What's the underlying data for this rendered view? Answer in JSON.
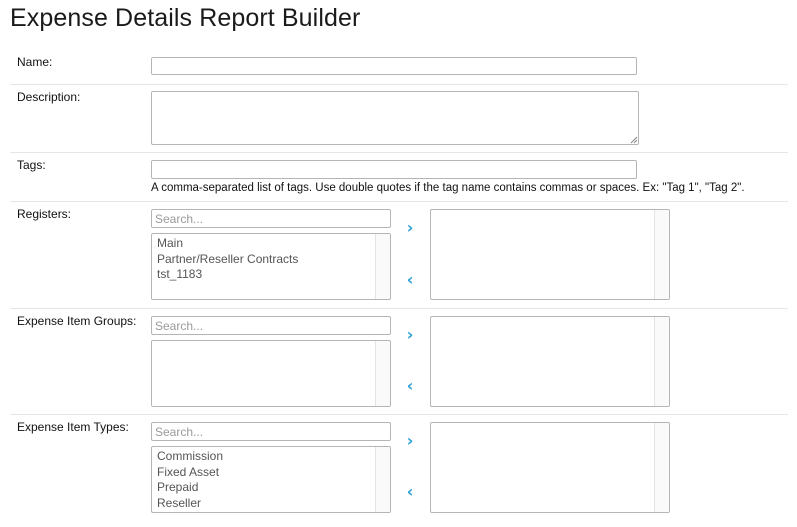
{
  "page": {
    "title": "Expense Details Report Builder"
  },
  "fields": {
    "name": {
      "label": "Name:",
      "value": ""
    },
    "description": {
      "label": "Description:",
      "value": ""
    },
    "tags": {
      "label": "Tags:",
      "value": "",
      "help": "A comma-separated list of tags. Use double quotes if the tag name contains commas or spaces. Ex: \"Tag 1\", \"Tag 2\"."
    }
  },
  "pickers": {
    "registers": {
      "label": "Registers:",
      "search_placeholder": "Search...",
      "available": [
        "Main",
        "Partner/Reseller Contracts",
        "tst_1183"
      ],
      "selected": []
    },
    "expense_item_groups": {
      "label": "Expense Item Groups:",
      "search_placeholder": "Search...",
      "available": [],
      "selected": []
    },
    "expense_item_types": {
      "label": "Expense Item Types:",
      "search_placeholder": "Search...",
      "available": [
        "Commission",
        "Fixed Asset",
        "Prepaid",
        "Reseller"
      ],
      "selected": []
    }
  },
  "icons": {
    "add": "chevron-right-icon",
    "remove": "chevron-left-icon"
  },
  "colors": {
    "accent": "#2a9fd6",
    "border": "#b5b5b5",
    "divider": "#e6e6e6"
  }
}
